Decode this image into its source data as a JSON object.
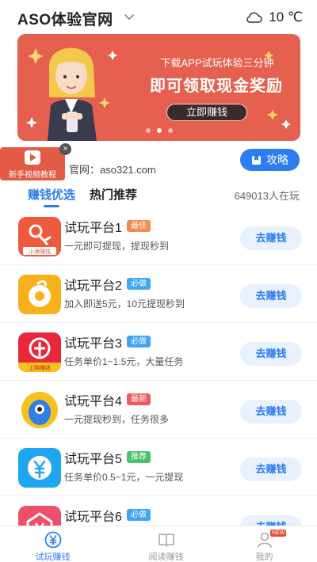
{
  "header": {
    "app_title": "ASO体验官网",
    "temperature": "10 ℃",
    "weather_icon": "cloud-icon"
  },
  "banner": {
    "line1": "下载APP试玩体验三分钟",
    "line2": "即可领取现金奖励",
    "button_label": "立即赚钱",
    "slide_count": 3,
    "active_slide": 2,
    "background_color": "#e5604e"
  },
  "video_tutorial": {
    "label": "新手视频教程",
    "close_glyph": "×"
  },
  "site": {
    "url_text": "官网：aso321.com"
  },
  "guide_button": {
    "label": "攻略"
  },
  "tabs": {
    "items": [
      {
        "label": "赚钱优选",
        "active": true
      },
      {
        "label": "热门推荐",
        "active": false
      }
    ],
    "online_count": "649013人在玩"
  },
  "list": {
    "items": [
      {
        "name": "试玩平台1",
        "badge": "最佳",
        "badge_color": "#f28a4a",
        "desc": "一元即可提现，提现秒到",
        "button": "去赚钱",
        "icon": "app-icon-1",
        "icon_caption": "小海赚钱"
      },
      {
        "name": "试玩平台2",
        "badge": "必做",
        "badge_color": "#3fa6f2",
        "desc": "加入即送5元，10元提现秒到",
        "button": "去赚钱",
        "icon": "app-icon-2"
      },
      {
        "name": "试玩平台3",
        "badge": "必做",
        "badge_color": "#3fa6f2",
        "desc": "任务单价1~1.5元，大量任务",
        "button": "去赚钱",
        "icon": "app-icon-3",
        "icon_caption": "上网赚钱"
      },
      {
        "name": "试玩平台4",
        "badge": "最新",
        "badge_color": "#ec5d5d",
        "desc": "一元提现秒到，任务很多",
        "button": "去赚钱",
        "icon": "app-icon-4"
      },
      {
        "name": "试玩平台5",
        "badge": "推荐",
        "badge_color": "#4cc16a",
        "desc": "任务单价0.5~1元，一元提现",
        "button": "去赚钱",
        "icon": "app-icon-5"
      },
      {
        "name": "试玩平台6",
        "badge": "必做",
        "badge_color": "#3fa6f2",
        "desc": "",
        "button": "去赚钱",
        "icon": "app-icon-6"
      }
    ]
  },
  "bottom_nav": {
    "items": [
      {
        "label": "试玩赚钱",
        "icon": "yen-coin-icon",
        "active": true
      },
      {
        "label": "阅读赚钱",
        "icon": "book-icon",
        "active": false
      },
      {
        "label": "我的",
        "icon": "user-icon",
        "active": false,
        "badge": "NEW"
      }
    ]
  },
  "colors": {
    "accent": "#2b7df0",
    "button_bg": "#e8f1fd"
  }
}
